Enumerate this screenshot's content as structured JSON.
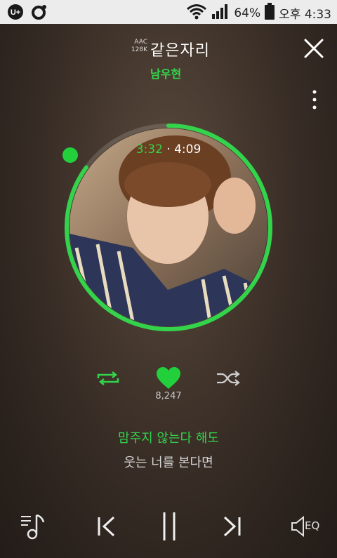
{
  "status_bar": {
    "battery_percent": "64%",
    "time": "오후 4:33",
    "icons": [
      "u-plus-icon",
      "ring-icon",
      "wifi-icon",
      "signal-icon",
      "battery-icon"
    ]
  },
  "player": {
    "codec": "AAC",
    "bitrate": "128K",
    "song_title": "같은자리",
    "artist": "남우현",
    "time_current": "3:32",
    "time_separator": "·",
    "time_total": "4:09",
    "progress_fraction": 0.85,
    "like_count": "8,247",
    "lyric_current": "맘주지 않는다 해도",
    "lyric_next": "웃는 너를 본다면",
    "eq_label": "EQ"
  },
  "colors": {
    "accent": "#33d44b",
    "status_bar_bg": "#ececec"
  }
}
